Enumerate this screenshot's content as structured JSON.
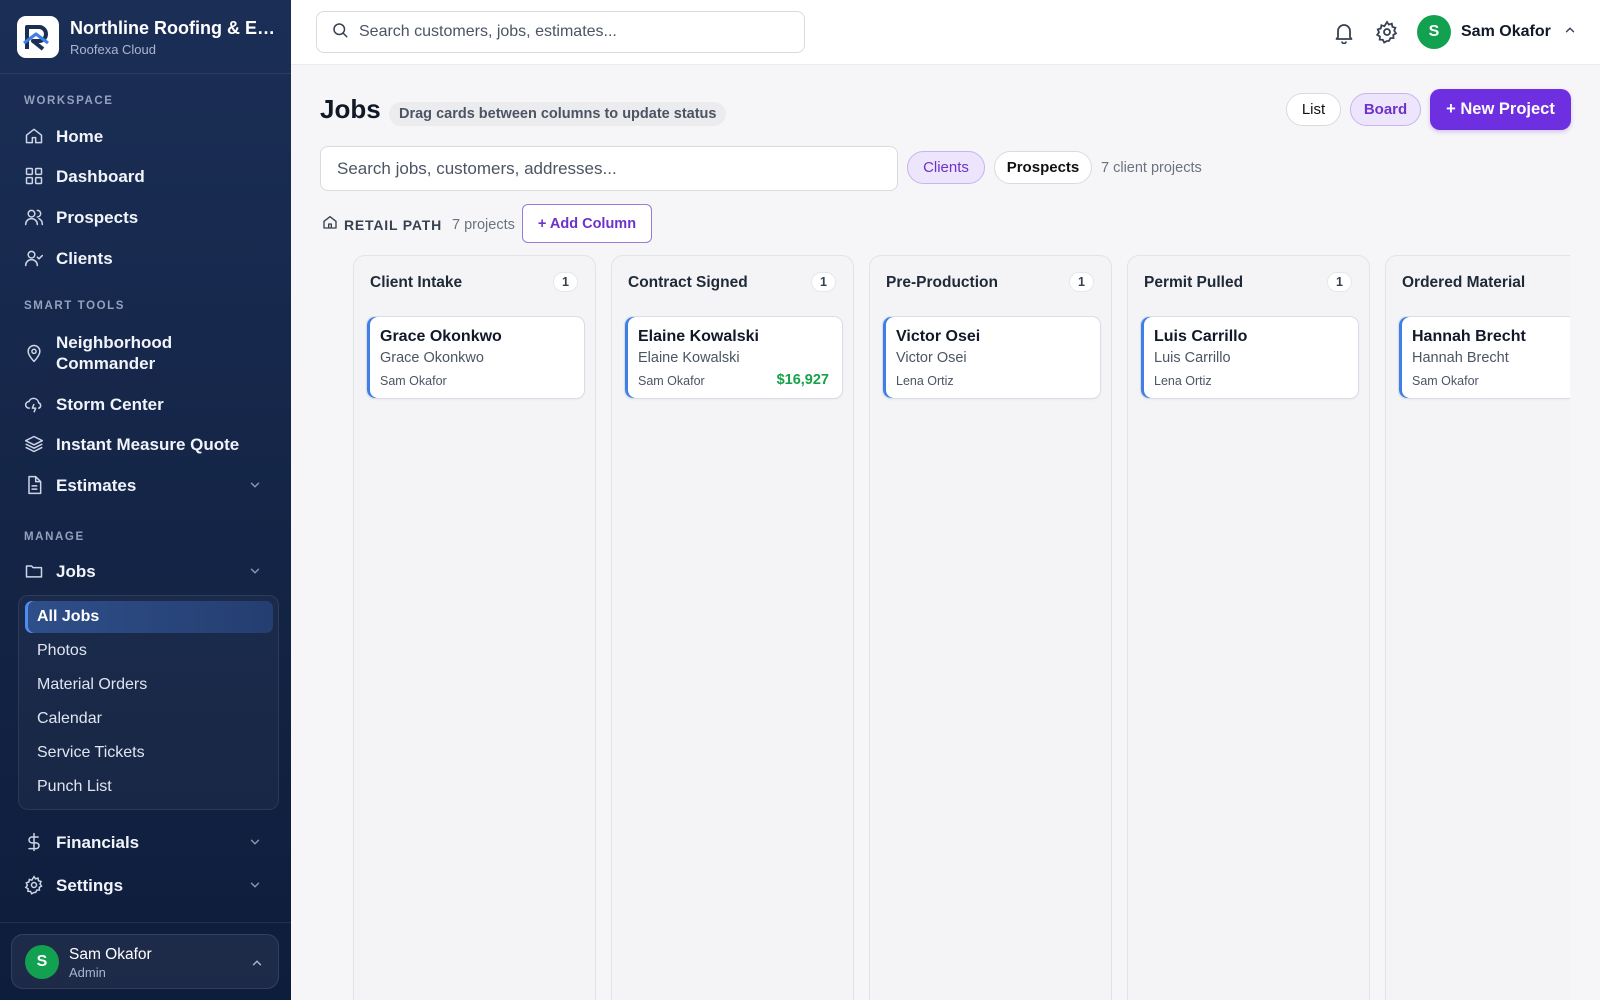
{
  "brand": {
    "name": "Northline Roofing & Ex...",
    "subtitle": "Roofexa Cloud",
    "logo_icon": "roof-r-logo-icon"
  },
  "sidebar": {
    "sections": {
      "workspace": "WORKSPACE",
      "smart_tools": "SMART TOOLS",
      "manage": "MANAGE"
    },
    "workspace_items": [
      {
        "label": "Home",
        "icon": "home-icon"
      },
      {
        "label": "Dashboard",
        "icon": "grid-icon"
      },
      {
        "label": "Prospects",
        "icon": "users-icon"
      },
      {
        "label": "Clients",
        "icon": "user-check-icon"
      }
    ],
    "smart_tools_items": [
      {
        "label": "Neighborhood Commander",
        "icon": "map-pin-icon"
      },
      {
        "label": "Storm Center",
        "icon": "cloud-lightning-icon"
      },
      {
        "label": "Instant Measure Quote",
        "icon": "layers-icon"
      },
      {
        "label": "Estimates",
        "icon": "file-text-icon"
      }
    ],
    "jobs": {
      "label": "Jobs",
      "icon": "folder-icon"
    },
    "jobs_sub_items": [
      "All Jobs",
      "Photos",
      "Material Orders",
      "Calendar",
      "Service Tickets",
      "Punch List"
    ],
    "jobs_active": "All Jobs",
    "financials": {
      "label": "Financials",
      "icon": "dollar-icon"
    },
    "settings": {
      "label": "Settings",
      "icon": "gear-icon"
    },
    "user": {
      "initial": "S",
      "name": "Sam Okafor",
      "role": "Admin"
    }
  },
  "topbar": {
    "search_placeholder": "Search customers, jobs, estimates...",
    "user_initial": "S",
    "user_name": "Sam Okafor"
  },
  "page": {
    "title": "Jobs",
    "hint": "Drag cards between columns to update status",
    "view_list": "List",
    "view_board": "Board",
    "new_project": "+ New Project",
    "job_search_placeholder": "Search jobs, customers, addresses...",
    "filter_clients": "Clients",
    "filter_prospects": "Prospects",
    "count_text": "7 client projects",
    "path_label": "RETAIL PATH",
    "path_count": "7 projects",
    "add_column": "+ Add Column"
  },
  "board": {
    "columns": [
      {
        "title": "Client Intake",
        "count": "1",
        "card": {
          "title": "Grace Okonkwo",
          "sub": "Grace Okonkwo",
          "owner": "Sam Okafor",
          "amount": ""
        }
      },
      {
        "title": "Contract Signed",
        "count": "1",
        "card": {
          "title": "Elaine Kowalski",
          "sub": "Elaine Kowalski",
          "owner": "Sam Okafor",
          "amount": "$16,927"
        }
      },
      {
        "title": "Pre-Production",
        "count": "1",
        "card": {
          "title": "Victor Osei",
          "sub": "Victor Osei",
          "owner": "Lena Ortiz",
          "amount": ""
        }
      },
      {
        "title": "Permit Pulled",
        "count": "1",
        "card": {
          "title": "Luis Carrillo",
          "sub": "Luis Carrillo",
          "owner": "Lena Ortiz",
          "amount": ""
        }
      },
      {
        "title": "Ordered Material",
        "count": "",
        "card": {
          "title": "Hannah Brecht",
          "sub": "Hannah Brecht",
          "owner": "Sam Okafor",
          "amount": ""
        }
      }
    ]
  },
  "colors": {
    "sidebar_bg": "#152649",
    "accent_purple": "#6e2fe0",
    "card_accent_blue": "#3f7fe6",
    "amount_green": "#16a34a",
    "avatar_green": "#12a150"
  }
}
